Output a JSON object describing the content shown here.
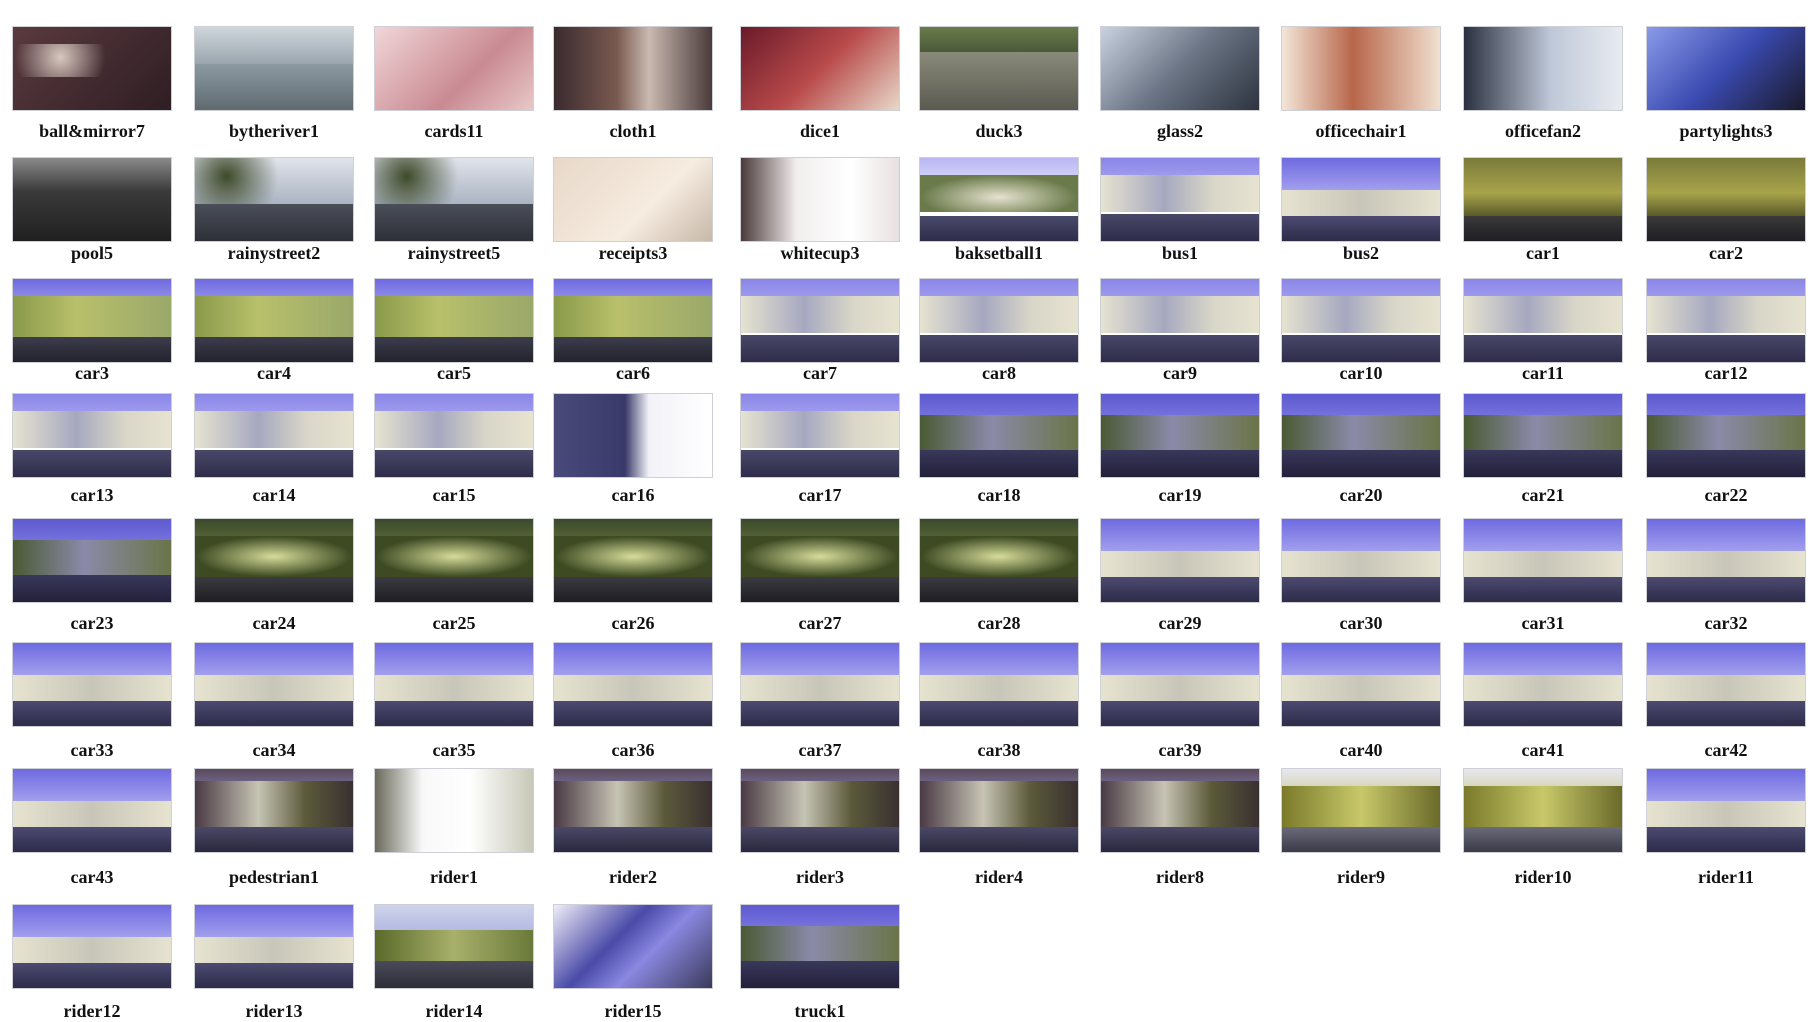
{
  "palette": {
    "ir_sky": "#8a86e8",
    "ir_sky_light": "#b9b6f4",
    "ir_tree": "#e6e3d0",
    "ir_road": "#2e2c4a",
    "dark_tree": "#3d4a22",
    "yellow_tree": "#a8a44a",
    "indoor_dark": "#3a2a30",
    "indoor_warm": "#9a6a50",
    "white_bg": "#e9e6ef"
  },
  "rows": [
    {
      "items": [
        {
          "label": "ball&mirror7",
          "scene": "indoor-dark",
          "icon": "ball-mirror-icon"
        },
        {
          "label": "bytheriver1",
          "scene": "street-gray",
          "icon": "street-icon"
        },
        {
          "label": "cards11",
          "scene": "cards",
          "icon": "cards-icon"
        },
        {
          "label": "cloth1",
          "scene": "indoor-room",
          "icon": "cloth-icon"
        },
        {
          "label": "dice1",
          "scene": "dice",
          "icon": "dice-icon"
        },
        {
          "label": "duck3",
          "scene": "water",
          "icon": "water-icon"
        },
        {
          "label": "glass2",
          "scene": "office",
          "icon": "glass-icon"
        },
        {
          "label": "officechair1",
          "scene": "office-warm",
          "icon": "chair-icon"
        },
        {
          "label": "officefan2",
          "scene": "office-fan",
          "icon": "fan-icon"
        },
        {
          "label": "partylights3",
          "scene": "lights",
          "icon": "light-icon"
        }
      ]
    },
    {
      "items": [
        {
          "label": "pool5",
          "scene": "pool",
          "icon": "pool-icon"
        },
        {
          "label": "rainystreet2",
          "scene": "rainy",
          "icon": "rain-icon"
        },
        {
          "label": "rainystreet5",
          "scene": "rainy",
          "icon": "rain-icon"
        },
        {
          "label": "receipts3",
          "scene": "receipts",
          "icon": "receipt-icon"
        },
        {
          "label": "whitecup3",
          "scene": "white-room",
          "icon": "cup-icon"
        },
        {
          "label": "baksetball1",
          "scene": "ir-park",
          "icon": "basketball-icon"
        },
        {
          "label": "bus1",
          "scene": "ir-building",
          "icon": "bus-icon"
        },
        {
          "label": "bus2",
          "scene": "ir-sky",
          "icon": "bus-icon"
        },
        {
          "label": "car1",
          "scene": "yellow-trees",
          "icon": "car-icon"
        },
        {
          "label": "car2",
          "scene": "yellow-trees",
          "icon": "car-icon"
        }
      ]
    },
    {
      "items": [
        {
          "label": "car3",
          "scene": "green-building",
          "icon": "car-icon"
        },
        {
          "label": "car4",
          "scene": "green-building",
          "icon": "car-icon"
        },
        {
          "label": "car5",
          "scene": "green-building",
          "icon": "car-icon"
        },
        {
          "label": "car6",
          "scene": "green-building",
          "icon": "car-icon"
        },
        {
          "label": "car7",
          "scene": "ir-building",
          "icon": "car-icon"
        },
        {
          "label": "car8",
          "scene": "ir-building",
          "icon": "car-icon"
        },
        {
          "label": "car9",
          "scene": "ir-building",
          "icon": "car-icon"
        },
        {
          "label": "car10",
          "scene": "ir-building",
          "icon": "car-icon"
        },
        {
          "label": "car11",
          "scene": "ir-building",
          "icon": "car-icon"
        },
        {
          "label": "car12",
          "scene": "ir-building",
          "icon": "car-icon"
        }
      ]
    },
    {
      "items": [
        {
          "label": "car13",
          "scene": "ir-building",
          "icon": "car-icon"
        },
        {
          "label": "car14",
          "scene": "ir-building",
          "icon": "car-icon"
        },
        {
          "label": "car15",
          "scene": "ir-building",
          "icon": "car-icon"
        },
        {
          "label": "car16",
          "scene": "truck-white",
          "icon": "truck-icon"
        },
        {
          "label": "car17",
          "scene": "ir-building",
          "icon": "car-icon"
        },
        {
          "label": "car18",
          "scene": "ir-building-dark",
          "icon": "car-icon"
        },
        {
          "label": "car19",
          "scene": "ir-building-dark",
          "icon": "car-icon"
        },
        {
          "label": "car20",
          "scene": "ir-building-dark",
          "icon": "car-icon"
        },
        {
          "label": "car21",
          "scene": "ir-building-dark",
          "icon": "car-icon"
        },
        {
          "label": "car22",
          "scene": "ir-building-dark",
          "icon": "car-icon"
        }
      ]
    },
    {
      "items": [
        {
          "label": "car23",
          "scene": "ir-building-dark",
          "icon": "car-icon"
        },
        {
          "label": "car24",
          "scene": "green-park",
          "icon": "car-icon"
        },
        {
          "label": "car25",
          "scene": "green-park",
          "icon": "car-icon"
        },
        {
          "label": "car26",
          "scene": "green-park",
          "icon": "car-icon"
        },
        {
          "label": "car27",
          "scene": "green-park",
          "icon": "car-icon"
        },
        {
          "label": "car28",
          "scene": "green-park",
          "icon": "car-icon"
        },
        {
          "label": "car29",
          "scene": "ir-sky",
          "icon": "car-icon"
        },
        {
          "label": "car30",
          "scene": "ir-sky",
          "icon": "car-icon"
        },
        {
          "label": "car31",
          "scene": "ir-sky",
          "icon": "car-icon"
        },
        {
          "label": "car32",
          "scene": "ir-sky",
          "icon": "car-icon"
        }
      ]
    },
    {
      "items": [
        {
          "label": "car33",
          "scene": "ir-sky",
          "icon": "car-icon"
        },
        {
          "label": "car34",
          "scene": "ir-sky",
          "icon": "car-icon"
        },
        {
          "label": "car35",
          "scene": "ir-sky",
          "icon": "car-icon"
        },
        {
          "label": "car36",
          "scene": "ir-sky",
          "icon": "car-icon"
        },
        {
          "label": "car37",
          "scene": "ir-sky",
          "icon": "car-icon"
        },
        {
          "label": "car38",
          "scene": "ir-sky",
          "icon": "car-icon"
        },
        {
          "label": "car39",
          "scene": "ir-sky",
          "icon": "car-icon"
        },
        {
          "label": "car40",
          "scene": "ir-sky",
          "icon": "car-icon"
        },
        {
          "label": "car41",
          "scene": "ir-sky",
          "icon": "car-icon"
        },
        {
          "label": "car42",
          "scene": "ir-sky",
          "icon": "car-icon"
        }
      ]
    },
    {
      "items": [
        {
          "label": "car43",
          "scene": "ir-sky",
          "icon": "car-icon"
        },
        {
          "label": "pedestrian1",
          "scene": "ir-park-dark",
          "icon": "pedestrian-icon"
        },
        {
          "label": "rider1",
          "scene": "white-bright",
          "icon": "rider-icon"
        },
        {
          "label": "rider2",
          "scene": "ir-park-dark",
          "icon": "rider-icon"
        },
        {
          "label": "rider3",
          "scene": "ir-park-dark",
          "icon": "rider-icon"
        },
        {
          "label": "rider4",
          "scene": "ir-park-dark",
          "icon": "rider-icon"
        },
        {
          "label": "rider8",
          "scene": "ir-park-dark",
          "icon": "rider-icon"
        },
        {
          "label": "rider9",
          "scene": "yellow-park",
          "icon": "rider-icon"
        },
        {
          "label": "rider10",
          "scene": "yellow-park",
          "icon": "rider-icon"
        },
        {
          "label": "rider11",
          "scene": "ir-sky",
          "icon": "rider-icon"
        }
      ]
    },
    {
      "items": [
        {
          "label": "rider12",
          "scene": "ir-sky",
          "icon": "rider-icon"
        },
        {
          "label": "rider13",
          "scene": "ir-sky",
          "icon": "rider-icon"
        },
        {
          "label": "rider14",
          "scene": "green-road",
          "icon": "rider-icon"
        },
        {
          "label": "rider15",
          "scene": "ir-road-building",
          "icon": "rider-icon"
        },
        {
          "label": "truck1",
          "scene": "ir-building-dark",
          "icon": "truck-icon"
        }
      ]
    }
  ]
}
